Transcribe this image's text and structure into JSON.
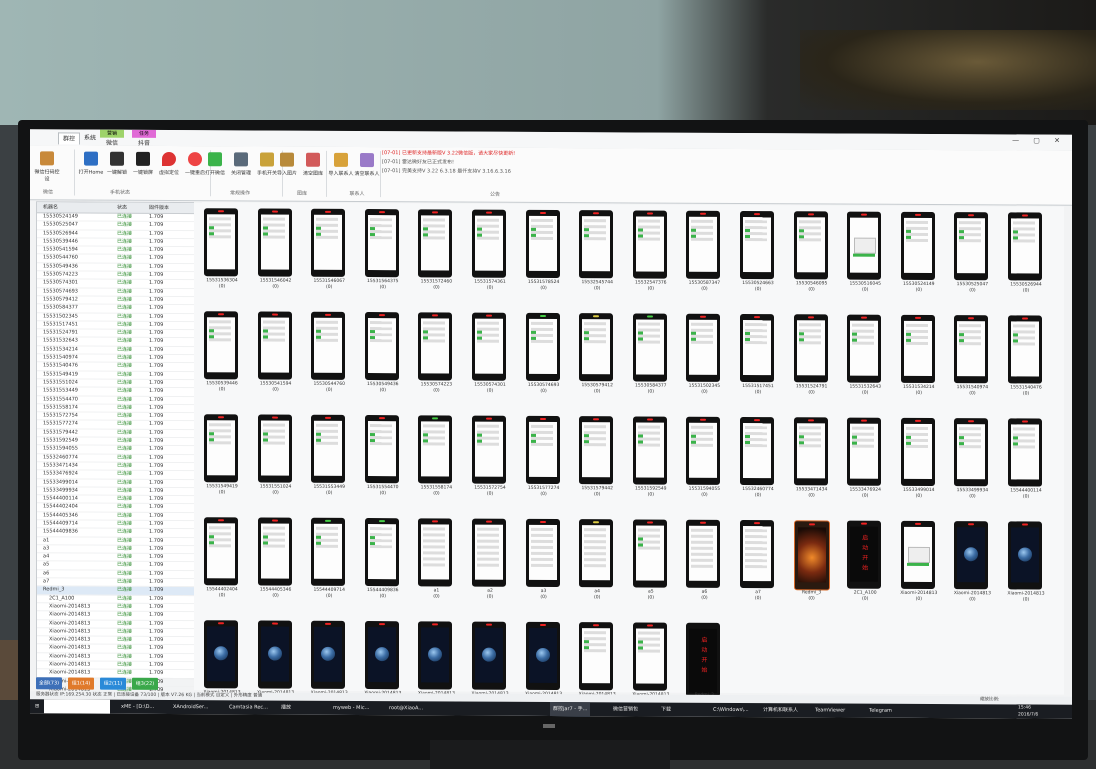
{
  "window": {
    "controls": "— ▢ ✕"
  },
  "ribbon_tabs": [
    {
      "label": "群控"
    },
    {
      "label": "系统"
    },
    {
      "label": "微信"
    },
    {
      "label": "抖音"
    }
  ],
  "context_tabs": [
    {
      "label": "营销"
    },
    {
      "label": "任务"
    }
  ],
  "ribbon_buttons": [
    {
      "label": "微信扫码控设"
    },
    {
      "label": "打开Home"
    },
    {
      "label": "一键解锁"
    },
    {
      "label": "一键锁屏"
    },
    {
      "label": "虚拟定位"
    },
    {
      "label": "一键重启"
    },
    {
      "label": "打开微信"
    },
    {
      "label": "关闭管理"
    },
    {
      "label": "手机开关"
    },
    {
      "label": "导入图片"
    },
    {
      "label": "清空图库"
    },
    {
      "label": "导入联系人"
    },
    {
      "label": "清空联系人"
    }
  ],
  "ribbon_groups": [
    {
      "label": "微信"
    },
    {
      "label": "手机状态"
    },
    {
      "label": "常规操作"
    },
    {
      "label": "图库"
    },
    {
      "label": "联系人"
    },
    {
      "label": "公告"
    }
  ],
  "news": [
    {
      "text": "[07-01] 已更新支持最新版V 3.22微信版，请大家尽快更新!",
      "red": true
    },
    {
      "text": "[07-01] 雷达微好友已正式发布!",
      "red": false
    },
    {
      "text": "[07-01] 完美支持V 3.22 6.3.18 最仟支持V 3.16.6.3.16",
      "red": false
    }
  ],
  "sidebar": {
    "headers": {
      "name": "机器名",
      "status": "状态",
      "version": "固件版本"
    },
    "rows": [
      {
        "name": "15530524149",
        "status": "已连接",
        "version": "1.709"
      },
      {
        "name": "15530525047",
        "status": "已连接",
        "version": "1.709"
      },
      {
        "name": "15530526944",
        "status": "已连接",
        "version": "1.709"
      },
      {
        "name": "15530539446",
        "status": "已连接",
        "version": "1.709"
      },
      {
        "name": "15530541594",
        "status": "已连接",
        "version": "1.709"
      },
      {
        "name": "15530544760",
        "status": "已连接",
        "version": "1.709"
      },
      {
        "name": "15530549436",
        "status": "已连接",
        "version": "1.709"
      },
      {
        "name": "15530574223",
        "status": "已连接",
        "version": "1.709"
      },
      {
        "name": "15530574301",
        "status": "已连接",
        "version": "1.709"
      },
      {
        "name": "15530574693",
        "status": "已连接",
        "version": "1.709"
      },
      {
        "name": "15530579412",
        "status": "已连接",
        "version": "1.709"
      },
      {
        "name": "15530584377",
        "status": "已连接",
        "version": "1.709"
      },
      {
        "name": "15531502345",
        "status": "已连接",
        "version": "1.709"
      },
      {
        "name": "15531517451",
        "status": "已连接",
        "version": "1.709"
      },
      {
        "name": "15531524791",
        "status": "已连接",
        "version": "1.709"
      },
      {
        "name": "15531532643",
        "status": "已连接",
        "version": "1.709"
      },
      {
        "name": "15531534214",
        "status": "已连接",
        "version": "1.709"
      },
      {
        "name": "15531540974",
        "status": "已连接",
        "version": "1.709"
      },
      {
        "name": "15531540476",
        "status": "已连接",
        "version": "1.709"
      },
      {
        "name": "15531549419",
        "status": "已连接",
        "version": "1.709"
      },
      {
        "name": "15531551024",
        "status": "已连接",
        "version": "1.709"
      },
      {
        "name": "15531553449",
        "status": "已连接",
        "version": "1.709"
      },
      {
        "name": "15531554470",
        "status": "已连接",
        "version": "1.709"
      },
      {
        "name": "15531558174",
        "status": "已连接",
        "version": "1.709"
      },
      {
        "name": "15531572754",
        "status": "已连接",
        "version": "1.709"
      },
      {
        "name": "15531577274",
        "status": "已连接",
        "version": "1.709"
      },
      {
        "name": "15531579442",
        "status": "已连接",
        "version": "1.709"
      },
      {
        "name": "15531592549",
        "status": "已连接",
        "version": "1.709"
      },
      {
        "name": "15531594055",
        "status": "已连接",
        "version": "1.709"
      },
      {
        "name": "15532460774",
        "status": "已连接",
        "version": "1.709"
      },
      {
        "name": "15533471434",
        "status": "已连接",
        "version": "1.709"
      },
      {
        "name": "15533476924",
        "status": "已连接",
        "version": "1.709"
      },
      {
        "name": "15533499014",
        "status": "已连接",
        "version": "1.709"
      },
      {
        "name": "15533499934",
        "status": "已连接",
        "version": "1.709"
      },
      {
        "name": "15544400114",
        "status": "已连接",
        "version": "1.709"
      },
      {
        "name": "15544402404",
        "status": "已连接",
        "version": "1.709"
      },
      {
        "name": "15544405346",
        "status": "已连接",
        "version": "1.709"
      },
      {
        "name": "15544409714",
        "status": "已连接",
        "version": "1.709"
      },
      {
        "name": "15544409836",
        "status": "已连接",
        "version": "1.709"
      },
      {
        "name": "a1",
        "status": "已连接",
        "version": "1.709"
      },
      {
        "name": "a3",
        "status": "已连接",
        "version": "1.709"
      },
      {
        "name": "a4",
        "status": "已连接",
        "version": "1.709"
      },
      {
        "name": "a5",
        "status": "已连接",
        "version": "1.709"
      },
      {
        "name": "a6",
        "status": "已连接",
        "version": "1.709"
      },
      {
        "name": "a7",
        "status": "已连接",
        "version": "1.709"
      },
      {
        "name": "Redmi_3",
        "status": "已连接",
        "version": "1.709"
      },
      {
        "name": "2C1_A100",
        "status": "已连接",
        "version": "1.709"
      },
      {
        "name": "Xiaomi-2014813",
        "status": "已连接",
        "version": "1.709"
      },
      {
        "name": "Xiaomi-2014813",
        "status": "已连接",
        "version": "1.709"
      },
      {
        "name": "Xiaomi-2014813",
        "status": "已连接",
        "version": "1.709"
      },
      {
        "name": "Xiaomi-2014813",
        "status": "已连接",
        "version": "1.709"
      },
      {
        "name": "Xiaomi-2014813",
        "status": "已连接",
        "version": "1.709"
      },
      {
        "name": "Xiaomi-2014813",
        "status": "已连接",
        "version": "1.709"
      },
      {
        "name": "Xiaomi-2014813",
        "status": "已连接",
        "version": "1.709"
      },
      {
        "name": "Xiaomi-2014813",
        "status": "已连接",
        "version": "1.709"
      },
      {
        "name": "Xiaomi-2014813",
        "status": "已连接",
        "version": "1.709"
      },
      {
        "name": "Xiaomi-2014813",
        "status": "已连接",
        "version": "1.709"
      },
      {
        "name": "Xiaomi-2014813",
        "status": "已连接",
        "version": "1.709"
      }
    ]
  },
  "phones": [
    {
      "label": "15531536304",
      "sub": "(0)",
      "screen": "app",
      "led": "red"
    },
    {
      "label": "15531546042",
      "sub": "(0)",
      "screen": "app",
      "led": "red"
    },
    {
      "label": "15531546067",
      "sub": "(0)",
      "screen": "app",
      "led": "red"
    },
    {
      "label": "15531564375",
      "sub": "(0)",
      "screen": "app",
      "led": "red"
    },
    {
      "label": "15531572460",
      "sub": "(0)",
      "screen": "app",
      "led": "red"
    },
    {
      "label": "15531574361",
      "sub": "(0)",
      "screen": "app",
      "led": "red"
    },
    {
      "label": "15531578524",
      "sub": "(0)",
      "screen": "app",
      "led": "red"
    },
    {
      "label": "15532545744",
      "sub": "(0)",
      "screen": "app",
      "led": "red"
    },
    {
      "label": "15532547376",
      "sub": "(0)",
      "screen": "app",
      "led": "red"
    },
    {
      "label": "15530587347",
      "sub": "(0)",
      "screen": "app",
      "led": "red"
    },
    {
      "label": "15530524663",
      "sub": "(0)",
      "screen": "app",
      "led": "red"
    },
    {
      "label": "15530546095",
      "sub": "(0)",
      "screen": "app",
      "led": "red"
    },
    {
      "label": "15530516045",
      "sub": "(0)",
      "screen": "dialog",
      "led": "red"
    },
    {
      "label": "15530524149",
      "sub": "(0)",
      "screen": "app",
      "led": "red"
    },
    {
      "label": "15530525047",
      "sub": "(0)",
      "screen": "app",
      "led": "red"
    },
    {
      "label": "15530526944",
      "sub": "(0)",
      "screen": "app",
      "led": "red"
    },
    {
      "label": "15530539446",
      "sub": "(0)",
      "screen": "app",
      "led": "red"
    },
    {
      "label": "15530541594",
      "sub": "(0)",
      "screen": "app",
      "led": "red"
    },
    {
      "label": "15530544760",
      "sub": "(0)",
      "screen": "app",
      "led": "red"
    },
    {
      "label": "15530549436",
      "sub": "(0)",
      "screen": "app",
      "led": "red"
    },
    {
      "label": "15530574223",
      "sub": "(0)",
      "screen": "app",
      "led": "red"
    },
    {
      "label": "15530574301",
      "sub": "(0)",
      "screen": "app",
      "led": "red"
    },
    {
      "label": "15530574693",
      "sub": "(0)",
      "screen": "app",
      "led": "green"
    },
    {
      "label": "15530579412",
      "sub": "(0)",
      "screen": "app",
      "led": "yellow"
    },
    {
      "label": "15530584377",
      "sub": "(0)",
      "screen": "app",
      "led": "green"
    },
    {
      "label": "15531502345",
      "sub": "(0)",
      "screen": "app",
      "led": "red"
    },
    {
      "label": "15531517451",
      "sub": "(0)",
      "screen": "app",
      "led": "red"
    },
    {
      "label": "15531524791",
      "sub": "(0)",
      "screen": "app",
      "led": "red"
    },
    {
      "label": "15531532643",
      "sub": "(0)",
      "screen": "app",
      "led": "red"
    },
    {
      "label": "15531534214",
      "sub": "(0)",
      "screen": "app",
      "led": "red"
    },
    {
      "label": "15531540974",
      "sub": "(0)",
      "screen": "app",
      "led": "red"
    },
    {
      "label": "15531540476",
      "sub": "(0)",
      "screen": "app",
      "led": "red"
    },
    {
      "label": "15531549419",
      "sub": "(0)",
      "screen": "app",
      "led": "red"
    },
    {
      "label": "15531551024",
      "sub": "(0)",
      "screen": "app",
      "led": "red"
    },
    {
      "label": "15531553449",
      "sub": "(0)",
      "screen": "app",
      "led": "red"
    },
    {
      "label": "15531554470",
      "sub": "(0)",
      "screen": "app",
      "led": "red"
    },
    {
      "label": "15531558174",
      "sub": "(0)",
      "screen": "app",
      "led": "green"
    },
    {
      "label": "15531572754",
      "sub": "(0)",
      "screen": "app",
      "led": "red"
    },
    {
      "label": "15531577274",
      "sub": "(0)",
      "screen": "app",
      "led": "red"
    },
    {
      "label": "15531579442",
      "sub": "(0)",
      "screen": "app",
      "led": "red"
    },
    {
      "label": "15531592549",
      "sub": "(0)",
      "screen": "app",
      "led": "red"
    },
    {
      "label": "15531594055",
      "sub": "(0)",
      "screen": "app",
      "led": "red"
    },
    {
      "label": "15532460774",
      "sub": "(0)",
      "screen": "app",
      "led": "red"
    },
    {
      "label": "15533471434",
      "sub": "(0)",
      "screen": "app",
      "led": "red"
    },
    {
      "label": "15533476924",
      "sub": "(0)",
      "screen": "app",
      "led": "red"
    },
    {
      "label": "15533499014",
      "sub": "(0)",
      "screen": "app",
      "led": "red"
    },
    {
      "label": "15533499934",
      "sub": "(0)",
      "screen": "app",
      "led": "red"
    },
    {
      "label": "15544400114",
      "sub": "(0)",
      "screen": "app",
      "led": "red"
    },
    {
      "label": "15544402404",
      "sub": "(0)",
      "screen": "app",
      "led": "red"
    },
    {
      "label": "15544405346",
      "sub": "(0)",
      "screen": "app",
      "led": "red"
    },
    {
      "label": "15544409714",
      "sub": "(0)",
      "screen": "app",
      "led": "green"
    },
    {
      "label": "15544409836",
      "sub": "(0)",
      "screen": "app",
      "led": "green"
    },
    {
      "label": "a1",
      "sub": "(0)",
      "screen": "list",
      "led": "red"
    },
    {
      "label": "a2",
      "sub": "(0)",
      "screen": "list",
      "led": "red"
    },
    {
      "label": "a3",
      "sub": "(0)",
      "screen": "list",
      "led": "red"
    },
    {
      "label": "a4",
      "sub": "(0)",
      "screen": "list",
      "led": "yellow"
    },
    {
      "label": "a5",
      "sub": "(0)",
      "screen": "app",
      "led": "red"
    },
    {
      "label": "a6",
      "sub": "(0)",
      "screen": "list",
      "led": "red"
    },
    {
      "label": "a7",
      "sub": "(0)",
      "screen": "list",
      "led": "red"
    },
    {
      "label": "Redmi_3",
      "sub": "(0)",
      "screen": "orange",
      "led": "red"
    },
    {
      "label": "2C1_A100",
      "sub": "(0)",
      "screen": "redtxt",
      "led": "red"
    },
    {
      "label": "Xiaomi-2014813",
      "sub": "(0)",
      "screen": "dialog",
      "led": "red"
    },
    {
      "label": "Xiaomi-2014813",
      "sub": "(0)",
      "screen": "earth",
      "led": "red"
    },
    {
      "label": "Xiaomi-2014813",
      "sub": "(0)",
      "screen": "earth",
      "led": "red"
    },
    {
      "label": "Xiaomi-2014813",
      "sub": "(0)",
      "screen": "earth",
      "led": "red"
    },
    {
      "label": "Xiaomi-2014813",
      "sub": "(0)",
      "screen": "earth",
      "led": "red"
    },
    {
      "label": "Xiaomi-2014813",
      "sub": "(0)",
      "screen": "earth",
      "led": "red"
    },
    {
      "label": "Xiaomi-2014813",
      "sub": "(0)",
      "screen": "earth",
      "led": "red"
    },
    {
      "label": "Xiaomi-2014813",
      "sub": "(0)",
      "screen": "earth",
      "led": "red"
    },
    {
      "label": "Xiaomi-2014813",
      "sub": "(0)",
      "screen": "earth",
      "led": "red"
    },
    {
      "label": "Xiaomi-2014813",
      "sub": "(0)",
      "screen": "earth",
      "led": "red"
    },
    {
      "label": "Xiaomi-2014813",
      "sub": "(0)",
      "screen": "app",
      "led": "red"
    },
    {
      "label": "Xiaomi-2014813",
      "sub": "(0)",
      "screen": "app",
      "led": "red"
    },
    {
      "label": "Redmi_3",
      "sub": "(0)",
      "screen": "redtxt2",
      "led": "red"
    }
  ],
  "redtxt_chars": [
    "启",
    "动",
    "开",
    "始"
  ],
  "bottom_buttons": [
    {
      "label": "全部(73)",
      "color": "#3d6fb8"
    },
    {
      "label": "组1(14)",
      "color": "#e07a2a"
    },
    {
      "label": "组2(11)",
      "color": "#2a8ad8"
    },
    {
      "label": "组3(22)",
      "color": "#3aa84a"
    }
  ],
  "statusbar": {
    "left": "服务器状态  IP:169.254.30  状态 正常 | 已连接设备 73/100 | 版本 V7.26 KG | 当前模式 自定义 | 外形精度 普通",
    "right": "缩放比例:"
  },
  "taskbar": [
    {
      "label": "xME - [D:\\D...",
      "active": false
    },
    {
      "label": "XAndroidSer...",
      "active": false
    },
    {
      "label": "Camtasia Rec...",
      "active": false
    },
    {
      "label": "播放",
      "active": false
    },
    {
      "label": "myweb - Mic...",
      "active": false
    },
    {
      "label": "root@XiaoA...",
      "active": false
    },
    {
      "label": "群控jar7 - 手...",
      "active": true
    },
    {
      "label": "微信营销包",
      "active": false
    },
    {
      "label": "下载",
      "active": false
    },
    {
      "label": "C:\\Windows\\...",
      "active": false
    },
    {
      "label": "计算机和联系人",
      "active": false
    },
    {
      "label": "TeamViewer",
      "active": false
    },
    {
      "label": "Telegram",
      "active": false
    }
  ],
  "clock": {
    "time": "15:46",
    "date": "2016/7/6"
  }
}
